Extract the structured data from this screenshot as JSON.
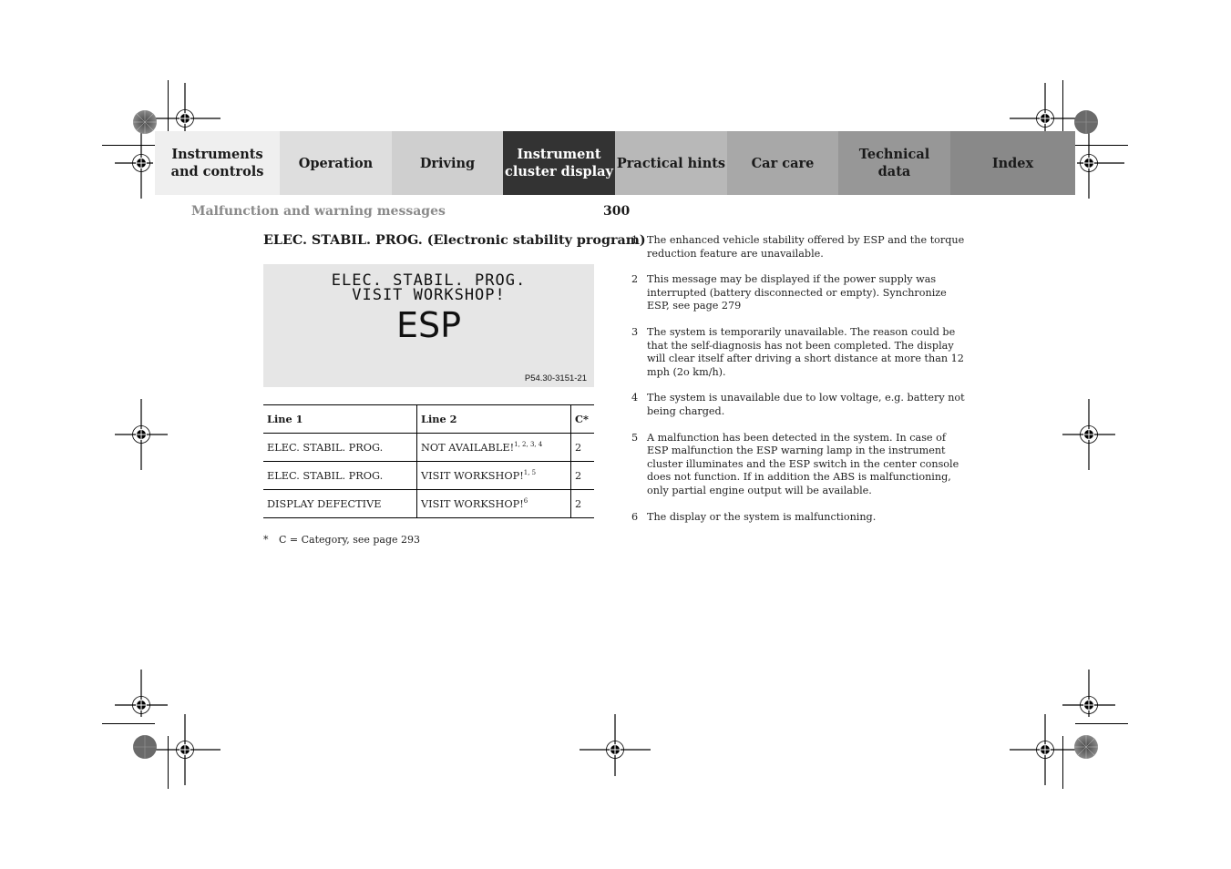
{
  "tabs": [
    {
      "label": "Instruments\nand controls",
      "bg": "#efefef",
      "fg": "#1a1a1a",
      "active": false
    },
    {
      "label": "Operation",
      "bg": "#dedede",
      "fg": "#1a1a1a",
      "active": false
    },
    {
      "label": "Driving",
      "bg": "#cfcfcf",
      "fg": "#1a1a1a",
      "active": false
    },
    {
      "label": "Instrument\ncluster display",
      "bg": "#333333",
      "fg": "#ffffff",
      "active": true
    },
    {
      "label": "Practical hints",
      "bg": "#b8b8b8",
      "fg": "#1a1a1a",
      "active": false
    },
    {
      "label": "Car care",
      "bg": "#a8a8a8",
      "fg": "#1a1a1a",
      "active": false
    },
    {
      "label": "Technical\ndata",
      "bg": "#979797",
      "fg": "#1a1a1a",
      "active": false
    },
    {
      "label": "Index",
      "bg": "#898989",
      "fg": "#1a1a1a",
      "active": false
    }
  ],
  "header": {
    "section_title": "Malfunction and warning messages",
    "page_number": "300"
  },
  "heading": "ELEC. STABIL. PROG. (Electronic stability program)",
  "display": {
    "line1": "ELEC. STABIL. PROG.",
    "line2": "VISIT WORKSHOP!",
    "symbol": "ESP",
    "figure_ref": "P54.30-3151-21"
  },
  "table": {
    "headers": [
      "Line 1",
      "Line 2",
      "C*"
    ],
    "rows": [
      {
        "line1": "ELEC. STABIL. PROG.",
        "line2": "NOT AVAILABLE!",
        "sup": "1, 2, 3, 4",
        "c": "2"
      },
      {
        "line1": "ELEC. STABIL. PROG.",
        "line2": "VISIT WORKSHOP!",
        "sup": "1, 5",
        "c": "2"
      },
      {
        "line1": "DISPLAY DEFECTIVE",
        "line2": "VISIT WORKSHOP!",
        "sup": "6",
        "c": "2"
      }
    ]
  },
  "footnote_star": {
    "mark": "*",
    "text": "C = Category, see page 293"
  },
  "notes": [
    {
      "num": "1",
      "text": "The enhanced vehicle stability offered by ESP and the torque reduction feature are unavailable."
    },
    {
      "num": "2",
      "text": "This message may be displayed if the power supply was interrupted (battery disconnected or empty). Synchronize ESP, see page 279"
    },
    {
      "num": "3",
      "text": "The system is temporarily unavailable. The reason could be that the self-diagnosis has not been completed. The display will clear itself after driving a short distance at more than 12 mph (2o km/h)."
    },
    {
      "num": "4",
      "text": "The system is unavailable due to low voltage, e.g. battery not being charged."
    },
    {
      "num": "5",
      "text": "A malfunction has been detected in the system. In case of ESP malfunction the ESP warning lamp in the instrument cluster illuminates and the ESP switch in the center console does not function. If in addition the ABS is malfunctioning, only partial engine output will be available."
    },
    {
      "num": "6",
      "text": "The display or the system is malfunctioning."
    }
  ]
}
